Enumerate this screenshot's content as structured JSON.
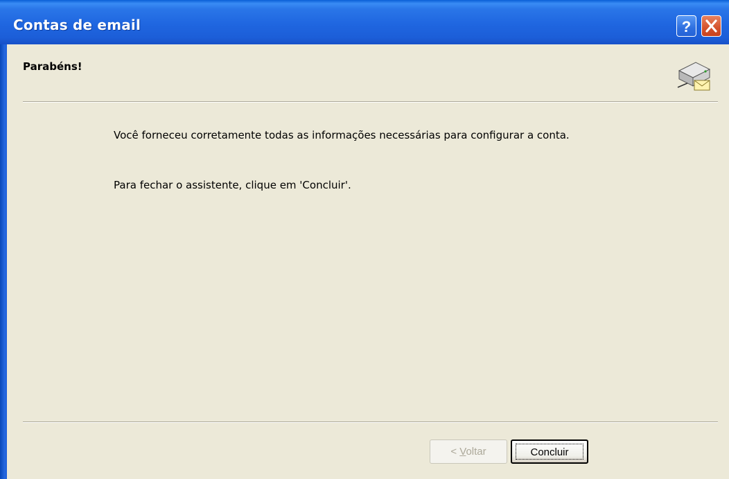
{
  "window": {
    "title": "Contas de email"
  },
  "header": {
    "title": "Parabéns!"
  },
  "body": {
    "line1": "Você forneceu corretamente todas as informações necessárias para configurar a conta.",
    "line2": "Para fechar o assistente, clique em 'Concluir'."
  },
  "buttons": {
    "back_prefix": "< ",
    "back_mnemonic": "V",
    "back_rest": "oltar",
    "finish": "Concluir"
  },
  "icons": {
    "help": "help-icon",
    "close": "close-icon",
    "wizard": "mail-server-icon"
  },
  "colors": {
    "titlebar": "#1F66E0",
    "dialog_bg": "#ECE9D8",
    "close_button": "#D4522C"
  }
}
